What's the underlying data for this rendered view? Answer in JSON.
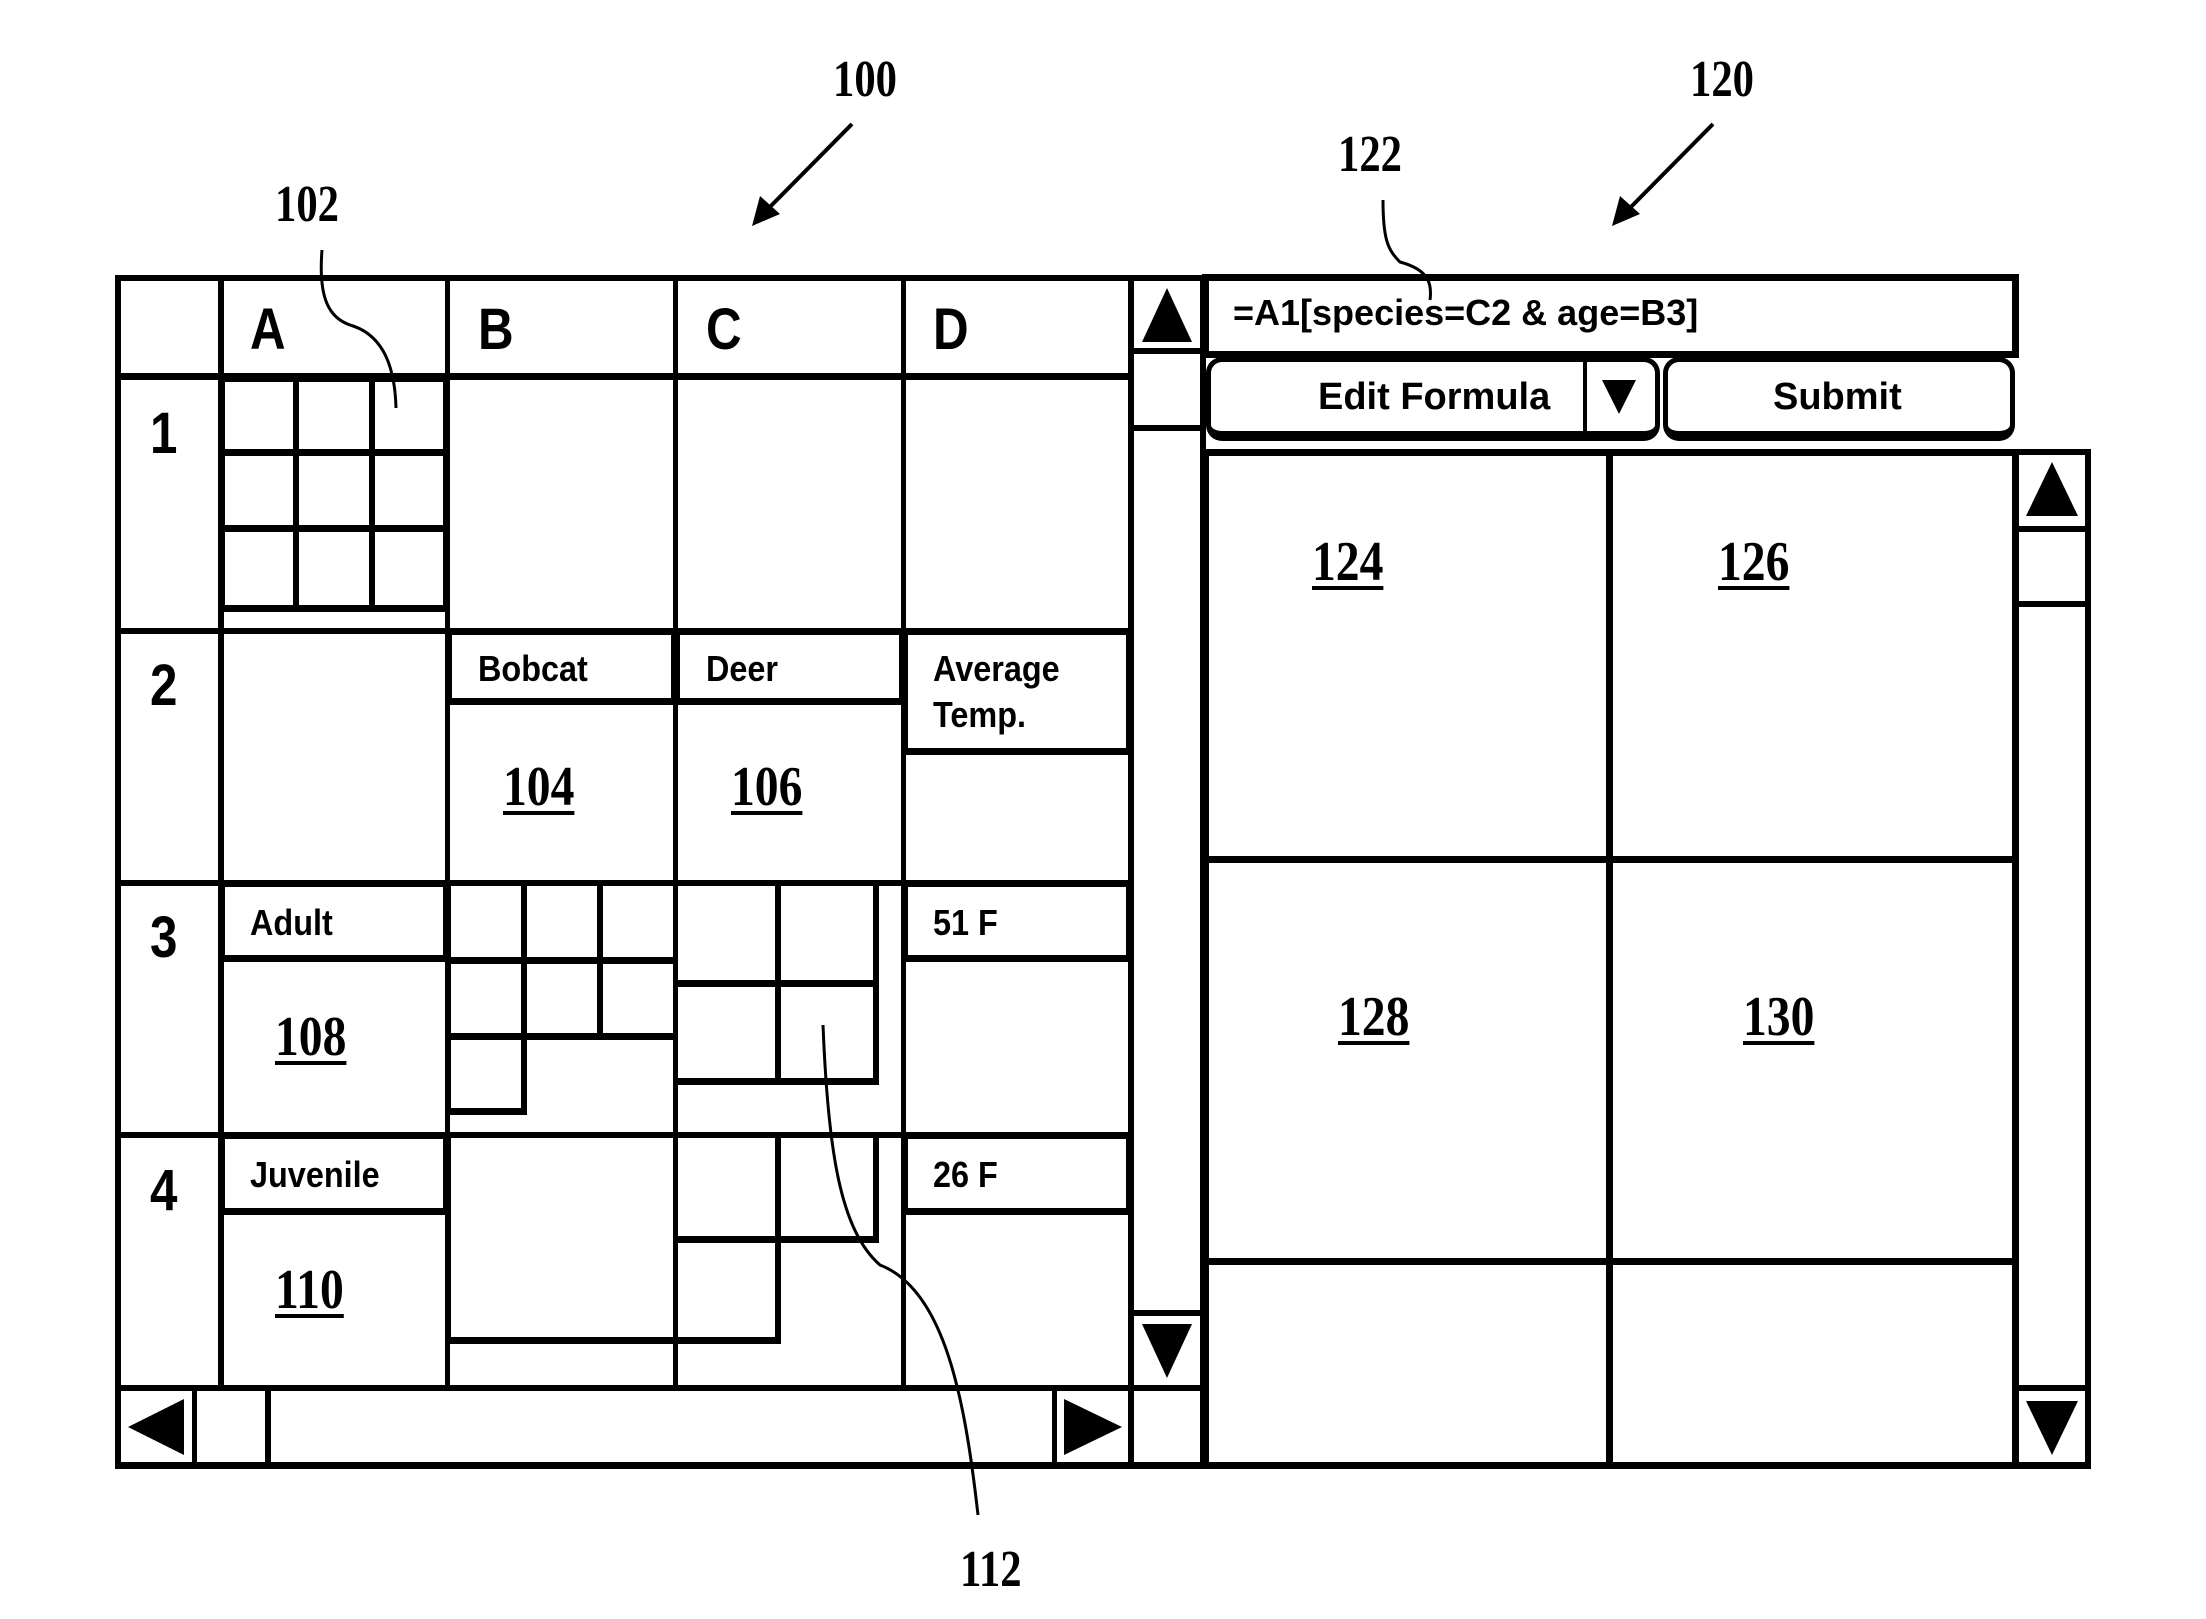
{
  "reference_numerals": {
    "spreadsheet": "100",
    "nested_cell": "102",
    "cell_bobcat": "104",
    "cell_deer": "106",
    "cell_adult": "108",
    "cell_juvenile": "110",
    "nested_grid": "112",
    "formula_panel": "120",
    "formula_bar": "122",
    "result_124": "124",
    "result_126": "126",
    "result_128": "128",
    "result_130": "130"
  },
  "spreadsheet": {
    "column_headers": [
      "A",
      "B",
      "C",
      "D"
    ],
    "row_headers": [
      "1",
      "2",
      "3",
      "4"
    ],
    "cells": {
      "B2": "Bobcat",
      "C2": "Deer",
      "D2": "Average Temp.",
      "A3": "Adult",
      "D3": "51 F",
      "A4": "Juvenile",
      "D4": "26 F"
    }
  },
  "formula_panel": {
    "formula": "=A1[species=C2 & age=B3]",
    "edit_button_label": "Edit Formula",
    "submit_button_label": "Submit"
  },
  "icons": {
    "scroll_up": "triangle-up",
    "scroll_down": "triangle-down",
    "scroll_left": "triangle-left",
    "scroll_right": "triangle-right",
    "dropdown": "triangle-down"
  }
}
